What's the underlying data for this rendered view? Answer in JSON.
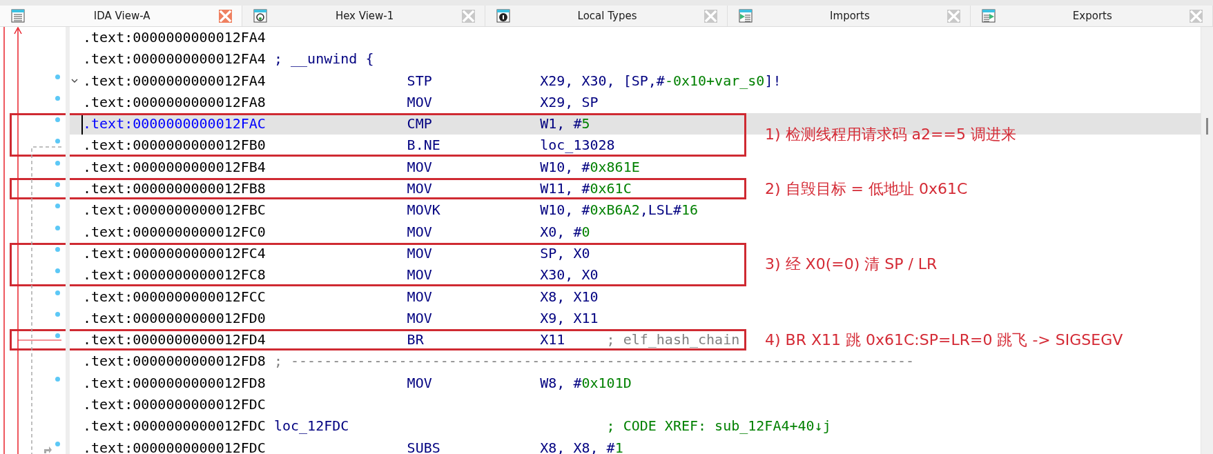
{
  "tabs": [
    {
      "label": "IDA View-A",
      "kind": "listing",
      "selected": true
    },
    {
      "label": "Hex View-1",
      "kind": "hex",
      "selected": false
    },
    {
      "label": "Local Types",
      "kind": "types",
      "selected": false
    },
    {
      "label": "Imports",
      "kind": "imports",
      "selected": false
    },
    {
      "label": "Exports",
      "kind": "exports",
      "selected": false
    }
  ],
  "listing": {
    "groups": [
      {
        "rows": [
          {
            "address": ".text:0000000000012FA4",
            "dot": false,
            "selected": false
          },
          {
            "address": ".text:0000000000012FA4",
            "dot": false,
            "selected": false,
            "remark": {
              "kind": "directive",
              "text": "; __unwind {"
            }
          },
          {
            "address": ".text:0000000000012FA4",
            "dot": true,
            "selected": false,
            "kind": "fold",
            "mnemonic": "STP",
            "operands": [
              {
                "kind": "reg",
                "text": "X29, X30, [SP,#"
              },
              {
                "kind": "num",
                "text": "-0x10+var_s0"
              },
              {
                "kind": "reg",
                "text": "]!"
              }
            ]
          },
          {
            "address": ".text:0000000000012FA8",
            "dot": true,
            "selected": false,
            "mnemonic": "MOV",
            "operands": [
              {
                "kind": "reg",
                "text": "X29, SP"
              }
            ]
          }
        ]
      },
      {
        "note": "1) 检测线程用请求码 a2==5 调进来",
        "rows": [
          {
            "address": ".text:0000000000012FAC",
            "dot": true,
            "selected": true,
            "mnemonic": "CMP",
            "operands": [
              {
                "kind": "reg",
                "text": "W1, #"
              },
              {
                "kind": "num",
                "text": "5"
              }
            ]
          },
          {
            "address": ".text:0000000000012FB0",
            "dot": true,
            "selected": false,
            "mnemonic": "B.NE",
            "operands": [
              {
                "kind": "reg",
                "text": "loc_13028"
              }
            ]
          }
        ]
      },
      {
        "rows": [
          {
            "address": ".text:0000000000012FB4",
            "dot": true,
            "selected": false,
            "mnemonic": "MOV",
            "operands": [
              {
                "kind": "reg",
                "text": "W10, #"
              },
              {
                "kind": "num",
                "text": "0x861E"
              }
            ]
          }
        ]
      },
      {
        "note": "2) 自毁目标 = 低地址 0x61C",
        "rows": [
          {
            "address": ".text:0000000000012FB8",
            "dot": true,
            "selected": false,
            "mnemonic": "MOV",
            "operands": [
              {
                "kind": "reg",
                "text": "W11, #"
              },
              {
                "kind": "num",
                "text": "0x61C"
              }
            ]
          }
        ]
      },
      {
        "rows": [
          {
            "address": ".text:0000000000012FBC",
            "dot": true,
            "selected": false,
            "mnemonic": "MOVK",
            "operands": [
              {
                "kind": "reg",
                "text": "W10, #"
              },
              {
                "kind": "num",
                "text": "0xB6A2"
              },
              {
                "kind": "reg",
                "text": ",LSL#"
              },
              {
                "kind": "num",
                "text": "16"
              }
            ]
          },
          {
            "address": ".text:0000000000012FC0",
            "dot": true,
            "selected": false,
            "mnemonic": "MOV",
            "operands": [
              {
                "kind": "reg",
                "text": "X0, #"
              },
              {
                "kind": "num",
                "text": "0"
              }
            ]
          }
        ]
      },
      {
        "note": "3) 经 X0(=0) 清 SP / LR",
        "rows": [
          {
            "address": ".text:0000000000012FC4",
            "dot": true,
            "selected": false,
            "mnemonic": "MOV",
            "operands": [
              {
                "kind": "reg",
                "text": "SP, X0"
              }
            ]
          },
          {
            "address": ".text:0000000000012FC8",
            "dot": true,
            "selected": false,
            "mnemonic": "MOV",
            "operands": [
              {
                "kind": "reg",
                "text": "X30, X0"
              }
            ]
          }
        ]
      },
      {
        "rows": [
          {
            "address": ".text:0000000000012FCC",
            "dot": true,
            "selected": false,
            "mnemonic": "MOV",
            "operands": [
              {
                "kind": "reg",
                "text": "X8, X10"
              }
            ]
          },
          {
            "address": ".text:0000000000012FD0",
            "dot": true,
            "selected": false,
            "mnemonic": "MOV",
            "operands": [
              {
                "kind": "reg",
                "text": "X9, X11"
              }
            ]
          }
        ]
      },
      {
        "note": "4) BR X11 跳 0x61C:SP=LR=0 跳飞 -> SIGSEGV",
        "rows": [
          {
            "address": ".text:0000000000012FD4",
            "dot": true,
            "selected": false,
            "mnemonic": "BR",
            "operands": [
              {
                "kind": "reg",
                "text": "X11"
              }
            ],
            "comment": {
              "kind": "plain",
              "text": "; elf_hash_chain"
            }
          }
        ]
      },
      {
        "rows": [
          {
            "address": ".text:0000000000012FD8",
            "dot": false,
            "selected": false,
            "remark": {
              "kind": "separator",
              "text": "; ---------------------------------------------------------------------------"
            }
          },
          {
            "address": ".text:0000000000012FD8",
            "dot": true,
            "selected": false,
            "mnemonic": "MOV",
            "operands": [
              {
                "kind": "reg",
                "text": "W8, #"
              },
              {
                "kind": "num",
                "text": "0x101D"
              }
            ]
          },
          {
            "address": ".text:0000000000012FDC",
            "dot": false,
            "selected": false
          },
          {
            "address": ".text:0000000000012FDC",
            "dot": false,
            "selected": false,
            "remark": {
              "kind": "label",
              "text": "loc_12FDC"
            },
            "comment": {
              "kind": "xref",
              "text": "; CODE XREF: sub_12FA4+40↓j"
            }
          },
          {
            "address": ".text:0000000000012FDC",
            "dot": true,
            "selected": false,
            "kind": "xref",
            "mnemonic": "SUBS",
            "operands": [
              {
                "kind": "reg",
                "text": "X8, X8, #"
              },
              {
                "kind": "num",
                "text": "1"
              }
            ]
          }
        ]
      }
    ]
  }
}
